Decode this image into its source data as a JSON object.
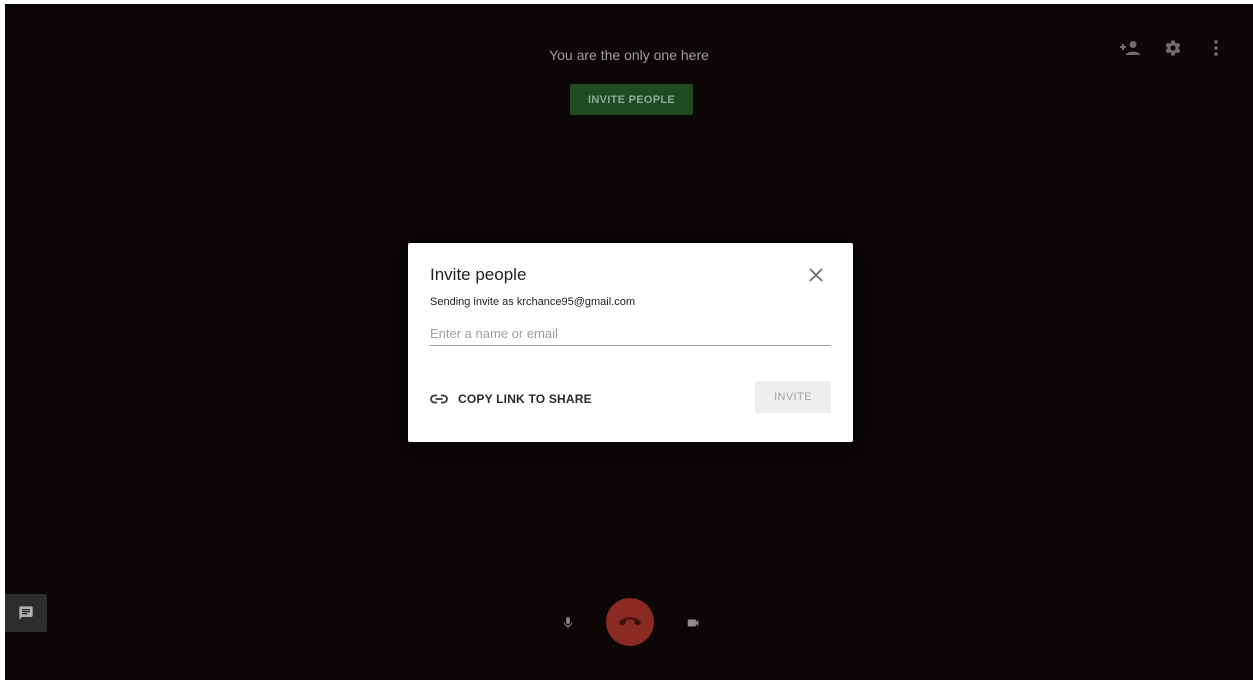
{
  "stage": {
    "status_text": "You are the only one here",
    "invite_button_label": "INVITE PEOPLE",
    "accent_color": "#1f4a22",
    "background_color": "#0c0606"
  },
  "top_icons": [
    "add-person-icon",
    "gear-icon",
    "more-vert-icon"
  ],
  "controls": {
    "icons": [
      "chat-icon",
      "mic-icon",
      "hangup-icon",
      "camera-icon"
    ],
    "hangup_color": "#8b2a22"
  },
  "dialog": {
    "title": "Invite people",
    "sender_text": "Sending invite as krchance95@gmail.com",
    "input_placeholder": "Enter a name or email",
    "input_value": "",
    "copy_link_label": "COPY LINK TO SHARE",
    "invite_button_label": "INVITE",
    "close_icon": "close-icon",
    "link_icon": "link-icon"
  }
}
